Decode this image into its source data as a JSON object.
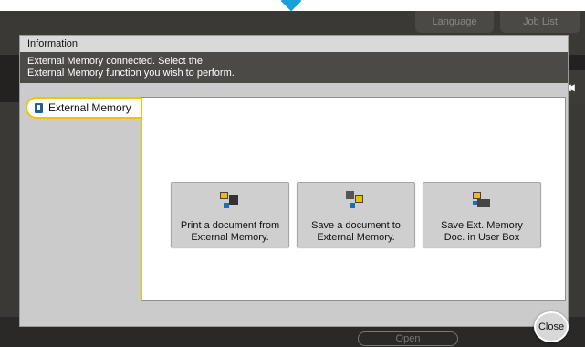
{
  "top_bar": {
    "language_label": "Language",
    "job_list_label": "Job List"
  },
  "background": {
    "open_label": "Open",
    "collapse_glyph": "◂◂"
  },
  "dialog": {
    "title": "Information",
    "message_line1": "External Memory connected. Select the",
    "message_line2": "External Memory function you wish to perform.",
    "tab_label": "External Memory",
    "buttons": [
      {
        "line1": "Print a document from",
        "line2": "External Memory.",
        "icon": "print-from-memory-icon"
      },
      {
        "line1": "Save a document to",
        "line2": "External Memory.",
        "icon": "save-to-memory-icon"
      },
      {
        "line1": "Save Ext. Memory",
        "line2": "Doc. in User Box",
        "icon": "save-to-user-box-icon"
      }
    ],
    "close_label": "Close"
  },
  "colors": {
    "accent": "#f0c400",
    "marker": "#1aa0d8"
  }
}
